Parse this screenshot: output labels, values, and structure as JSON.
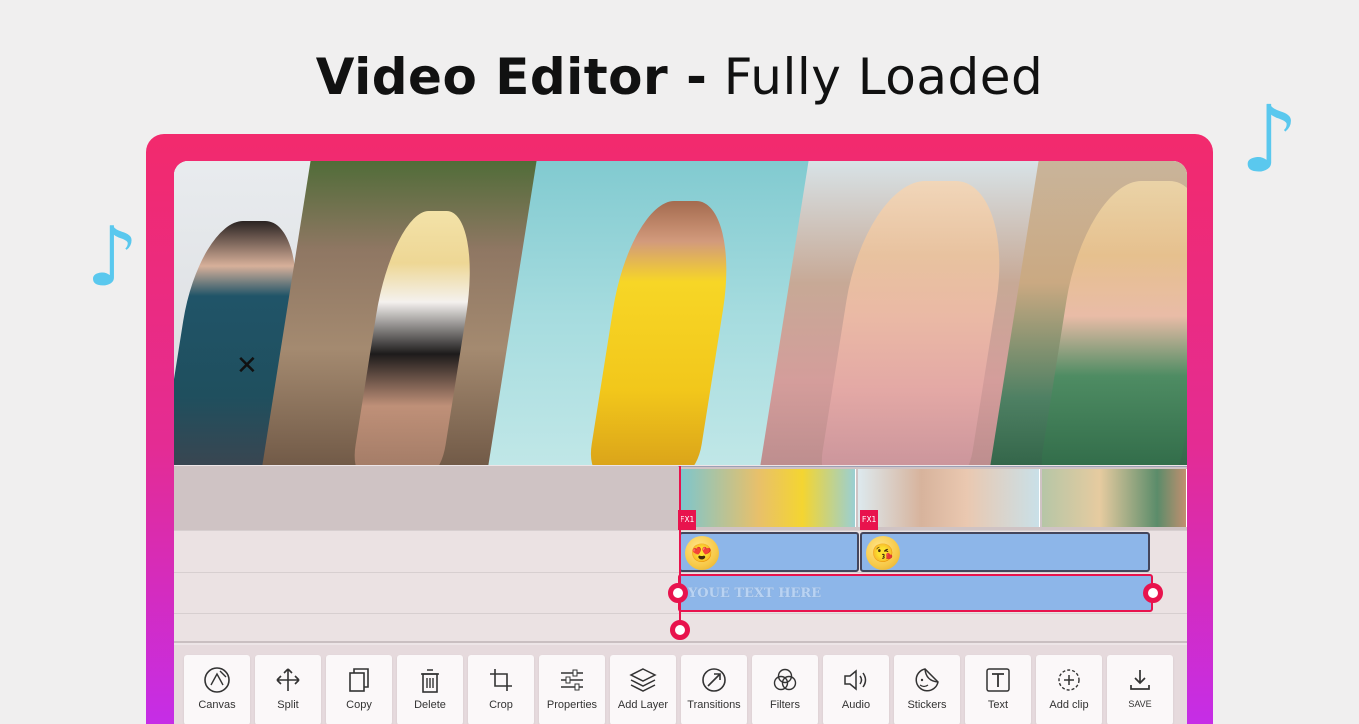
{
  "title": {
    "bold": "Video Editor -",
    "light": "Fully Loaded"
  },
  "decor": {
    "note_left": "♪",
    "note_right": "♪"
  },
  "preview": {
    "remove_mark": "✕"
  },
  "timeline": {
    "fx_tag_1": "FX1",
    "fx_tag_2": "FX1",
    "text_clip": "YOUE TEXT HERE",
    "sticker_1": "😍",
    "sticker_2": "😘"
  },
  "toolbar": {
    "items": [
      {
        "label": "Canvas",
        "icon": "canvas-icon"
      },
      {
        "label": "Split",
        "icon": "split-icon"
      },
      {
        "label": "Copy",
        "icon": "copy-icon"
      },
      {
        "label": "Delete",
        "icon": "delete-icon"
      },
      {
        "label": "Crop",
        "icon": "crop-icon"
      },
      {
        "label": "Properties",
        "icon": "properties-icon"
      },
      {
        "label": "Add Layer",
        "icon": "add-layer-icon"
      },
      {
        "label": "Transitions",
        "icon": "transitions-icon"
      },
      {
        "label": "Filters",
        "icon": "filters-icon"
      },
      {
        "label": "Audio",
        "icon": "audio-icon"
      },
      {
        "label": "Stickers",
        "icon": "stickers-icon"
      },
      {
        "label": "Text",
        "icon": "text-icon"
      },
      {
        "label": "Add clip",
        "icon": "add-clip-icon"
      },
      {
        "label": "SAVE",
        "icon": "save-icon"
      }
    ]
  },
  "colors": {
    "accent": "#e8134d",
    "frame_top": "#f22a6d",
    "frame_bottom": "#c22df0",
    "note": "#5ac8ee",
    "clip": "#8db6e9"
  }
}
